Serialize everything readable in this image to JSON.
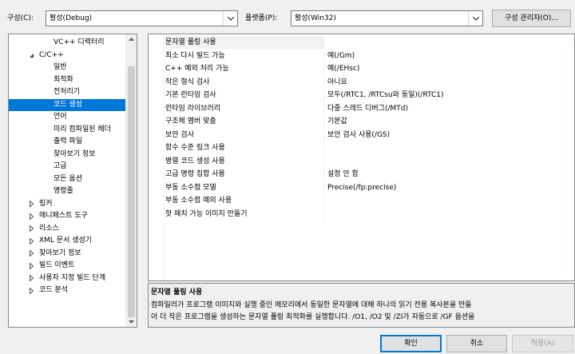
{
  "toolbar": {
    "config_label": "구성(C):",
    "config_value": "활성(Debug)",
    "platform_label": "플랫폼(P):",
    "platform_value": "활성(Win32)",
    "config_manager_label": "구성 관리자(O)..."
  },
  "tree": {
    "items": [
      {
        "label": "VC++ 디렉터리",
        "indent": 2,
        "expander": "none",
        "selected": false
      },
      {
        "label": "C/C++",
        "indent": 1,
        "expander": "expanded",
        "selected": false
      },
      {
        "label": "일반",
        "indent": 2,
        "expander": "none",
        "selected": false
      },
      {
        "label": "최적화",
        "indent": 2,
        "expander": "none",
        "selected": false
      },
      {
        "label": "전처리기",
        "indent": 2,
        "expander": "none",
        "selected": false
      },
      {
        "label": "코드 생성",
        "indent": 2,
        "expander": "none",
        "selected": true
      },
      {
        "label": "언어",
        "indent": 2,
        "expander": "none",
        "selected": false
      },
      {
        "label": "미리 컴파일된 헤더",
        "indent": 2,
        "expander": "none",
        "selected": false
      },
      {
        "label": "출력 파일",
        "indent": 2,
        "expander": "none",
        "selected": false
      },
      {
        "label": "찾아보기 정보",
        "indent": 2,
        "expander": "none",
        "selected": false
      },
      {
        "label": "고급",
        "indent": 2,
        "expander": "none",
        "selected": false
      },
      {
        "label": "모든 옵션",
        "indent": 2,
        "expander": "none",
        "selected": false
      },
      {
        "label": "명령줄",
        "indent": 2,
        "expander": "none",
        "selected": false
      },
      {
        "label": "링커",
        "indent": 1,
        "expander": "collapsed",
        "selected": false
      },
      {
        "label": "매니페스트 도구",
        "indent": 1,
        "expander": "collapsed",
        "selected": false
      },
      {
        "label": "리소스",
        "indent": 1,
        "expander": "collapsed",
        "selected": false
      },
      {
        "label": "XML 문서 생성기",
        "indent": 1,
        "expander": "collapsed",
        "selected": false
      },
      {
        "label": "찾아보기 정보",
        "indent": 1,
        "expander": "collapsed",
        "selected": false
      },
      {
        "label": "빌드 이벤트",
        "indent": 1,
        "expander": "collapsed",
        "selected": false
      },
      {
        "label": "사용자 지정 빌드 단계",
        "indent": 1,
        "expander": "collapsed",
        "selected": false
      },
      {
        "label": "코드 분석",
        "indent": 1,
        "expander": "collapsed",
        "selected": false
      }
    ]
  },
  "grid": {
    "rows": [
      {
        "name": "문자열 풀링 사용",
        "value": "",
        "selected": true
      },
      {
        "name": "최소 다시 빌드 가능",
        "value": "예(/Gm)",
        "selected": false
      },
      {
        "name": "C++ 예외 처리 가능",
        "value": "예(/EHsc)",
        "selected": false
      },
      {
        "name": "작은 형식 검사",
        "value": "아니요",
        "selected": false
      },
      {
        "name": "기본 런타임 검사",
        "value": "모두(/RTC1, /RTCsu와 동일)(/RTC1)",
        "selected": false
      },
      {
        "name": "런타임 라이브러리",
        "value": "다중 스레드 디버그(/MTd)",
        "selected": false
      },
      {
        "name": "구조체 멤버 맞춤",
        "value": "기본값",
        "selected": false
      },
      {
        "name": "보안 검사",
        "value": "보안 검사 사용(/GS)",
        "selected": false
      },
      {
        "name": "함수 수준 링크 사용",
        "value": "",
        "selected": false
      },
      {
        "name": "병렬 코드 생성 사용",
        "value": "",
        "selected": false
      },
      {
        "name": "고급 명령 집합 사용",
        "value": "설정 안 함",
        "selected": false
      },
      {
        "name": "부동 소수점 모델",
        "value": "Precise(/fp:precise)",
        "selected": false
      },
      {
        "name": "부동 소수점 예외 사용",
        "value": "",
        "selected": false
      },
      {
        "name": "핫 패치 가능 이미지 만들기",
        "value": "",
        "selected": false
      }
    ]
  },
  "description": {
    "title": "문자열 풀링 사용",
    "line1": "컴파일러가 프로그램 이미지와 실행 중인 메모리에서 동일한 문자열에 대해 하나의 읽기 전용 복사본을 만들",
    "line2": "어 더 작은 프로그램을 생성하는 문자열 풀링 최적화를 실행합니다. /O1, /O2 및 /ZI가 자동으로 /GF 옵션을 "
  },
  "buttons": {
    "ok": "확인",
    "cancel": "취소",
    "apply": "적용(A)"
  },
  "colors": {
    "selection": "#0078d7",
    "window_bg": "#f0f0f0"
  }
}
